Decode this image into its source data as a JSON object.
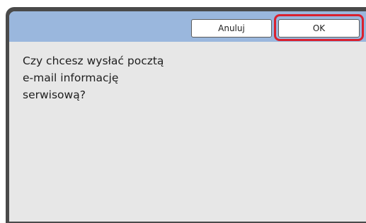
{
  "dialog": {
    "buttons": {
      "cancel_label": "Anuluj",
      "ok_label": "OK"
    },
    "message_lines": [
      "Czy chcesz wysłać pocztą",
      "e-mail informację",
      "serwisową?"
    ]
  },
  "colors": {
    "header_bar": "#9ab7dd",
    "body": "#e7e7e7",
    "highlight": "#d9212f",
    "bezel": "#4a4a4a"
  }
}
